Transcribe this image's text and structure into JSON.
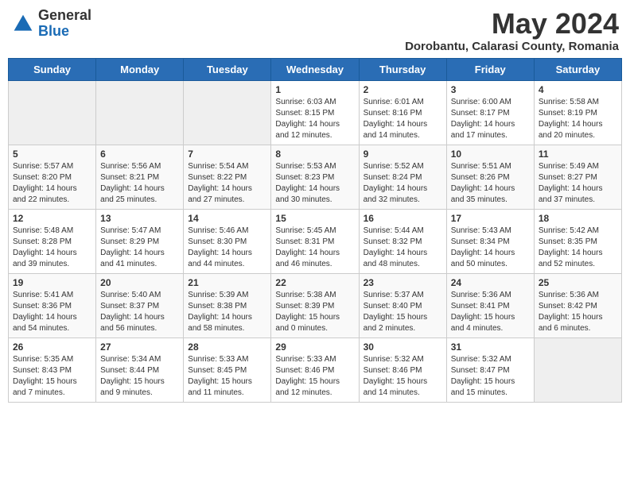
{
  "header": {
    "logo_general": "General",
    "logo_blue": "Blue",
    "month_year": "May 2024",
    "location": "Dorobantu, Calarasi County, Romania"
  },
  "days_of_week": [
    "Sunday",
    "Monday",
    "Tuesday",
    "Wednesday",
    "Thursday",
    "Friday",
    "Saturday"
  ],
  "weeks": [
    [
      {
        "day": "",
        "info": ""
      },
      {
        "day": "",
        "info": ""
      },
      {
        "day": "",
        "info": ""
      },
      {
        "day": "1",
        "info": "Sunrise: 6:03 AM\nSunset: 8:15 PM\nDaylight: 14 hours and 12 minutes."
      },
      {
        "day": "2",
        "info": "Sunrise: 6:01 AM\nSunset: 8:16 PM\nDaylight: 14 hours and 14 minutes."
      },
      {
        "day": "3",
        "info": "Sunrise: 6:00 AM\nSunset: 8:17 PM\nDaylight: 14 hours and 17 minutes."
      },
      {
        "day": "4",
        "info": "Sunrise: 5:58 AM\nSunset: 8:19 PM\nDaylight: 14 hours and 20 minutes."
      }
    ],
    [
      {
        "day": "5",
        "info": "Sunrise: 5:57 AM\nSunset: 8:20 PM\nDaylight: 14 hours and 22 minutes."
      },
      {
        "day": "6",
        "info": "Sunrise: 5:56 AM\nSunset: 8:21 PM\nDaylight: 14 hours and 25 minutes."
      },
      {
        "day": "7",
        "info": "Sunrise: 5:54 AM\nSunset: 8:22 PM\nDaylight: 14 hours and 27 minutes."
      },
      {
        "day": "8",
        "info": "Sunrise: 5:53 AM\nSunset: 8:23 PM\nDaylight: 14 hours and 30 minutes."
      },
      {
        "day": "9",
        "info": "Sunrise: 5:52 AM\nSunset: 8:24 PM\nDaylight: 14 hours and 32 minutes."
      },
      {
        "day": "10",
        "info": "Sunrise: 5:51 AM\nSunset: 8:26 PM\nDaylight: 14 hours and 35 minutes."
      },
      {
        "day": "11",
        "info": "Sunrise: 5:49 AM\nSunset: 8:27 PM\nDaylight: 14 hours and 37 minutes."
      }
    ],
    [
      {
        "day": "12",
        "info": "Sunrise: 5:48 AM\nSunset: 8:28 PM\nDaylight: 14 hours and 39 minutes."
      },
      {
        "day": "13",
        "info": "Sunrise: 5:47 AM\nSunset: 8:29 PM\nDaylight: 14 hours and 41 minutes."
      },
      {
        "day": "14",
        "info": "Sunrise: 5:46 AM\nSunset: 8:30 PM\nDaylight: 14 hours and 44 minutes."
      },
      {
        "day": "15",
        "info": "Sunrise: 5:45 AM\nSunset: 8:31 PM\nDaylight: 14 hours and 46 minutes."
      },
      {
        "day": "16",
        "info": "Sunrise: 5:44 AM\nSunset: 8:32 PM\nDaylight: 14 hours and 48 minutes."
      },
      {
        "day": "17",
        "info": "Sunrise: 5:43 AM\nSunset: 8:34 PM\nDaylight: 14 hours and 50 minutes."
      },
      {
        "day": "18",
        "info": "Sunrise: 5:42 AM\nSunset: 8:35 PM\nDaylight: 14 hours and 52 minutes."
      }
    ],
    [
      {
        "day": "19",
        "info": "Sunrise: 5:41 AM\nSunset: 8:36 PM\nDaylight: 14 hours and 54 minutes."
      },
      {
        "day": "20",
        "info": "Sunrise: 5:40 AM\nSunset: 8:37 PM\nDaylight: 14 hours and 56 minutes."
      },
      {
        "day": "21",
        "info": "Sunrise: 5:39 AM\nSunset: 8:38 PM\nDaylight: 14 hours and 58 minutes."
      },
      {
        "day": "22",
        "info": "Sunrise: 5:38 AM\nSunset: 8:39 PM\nDaylight: 15 hours and 0 minutes."
      },
      {
        "day": "23",
        "info": "Sunrise: 5:37 AM\nSunset: 8:40 PM\nDaylight: 15 hours and 2 minutes."
      },
      {
        "day": "24",
        "info": "Sunrise: 5:36 AM\nSunset: 8:41 PM\nDaylight: 15 hours and 4 minutes."
      },
      {
        "day": "25",
        "info": "Sunrise: 5:36 AM\nSunset: 8:42 PM\nDaylight: 15 hours and 6 minutes."
      }
    ],
    [
      {
        "day": "26",
        "info": "Sunrise: 5:35 AM\nSunset: 8:43 PM\nDaylight: 15 hours and 7 minutes."
      },
      {
        "day": "27",
        "info": "Sunrise: 5:34 AM\nSunset: 8:44 PM\nDaylight: 15 hours and 9 minutes."
      },
      {
        "day": "28",
        "info": "Sunrise: 5:33 AM\nSunset: 8:45 PM\nDaylight: 15 hours and 11 minutes."
      },
      {
        "day": "29",
        "info": "Sunrise: 5:33 AM\nSunset: 8:46 PM\nDaylight: 15 hours and 12 minutes."
      },
      {
        "day": "30",
        "info": "Sunrise: 5:32 AM\nSunset: 8:46 PM\nDaylight: 15 hours and 14 minutes."
      },
      {
        "day": "31",
        "info": "Sunrise: 5:32 AM\nSunset: 8:47 PM\nDaylight: 15 hours and 15 minutes."
      },
      {
        "day": "",
        "info": ""
      }
    ]
  ]
}
